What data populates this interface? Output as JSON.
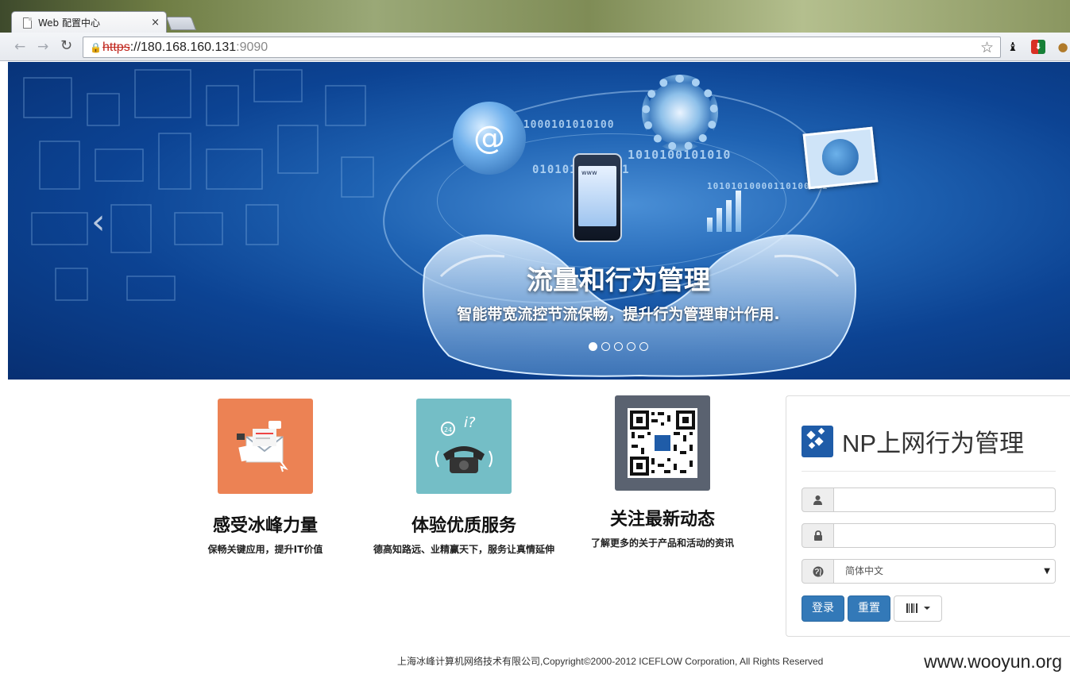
{
  "browser": {
    "tab_title": "Web 配置中心",
    "tab_close": "×",
    "url_scheme": "https",
    "url_sep": "://",
    "url_host": "180.168.160.131",
    "url_port": ":9090"
  },
  "banner": {
    "title": "流量和行为管理",
    "subtitle": "智能带宽流控节流保畅，提升行为管理审计作用.",
    "slide_count": 5,
    "active_slide": 1,
    "prev_glyph": "‹",
    "phone_text": "www",
    "binary": [
      "11000101010100",
      "1010100101010",
      "0101010010101",
      "10101010000110100101"
    ]
  },
  "features": [
    {
      "title": "感受冰峰力量",
      "desc": "保畅关键应用，提升IT价值",
      "color": "#ec8254",
      "icon": "email-icon"
    },
    {
      "title": "体验优质服务",
      "desc": "德高知路远、业精赢天下，服务让真情延伸",
      "color": "#74bec6",
      "icon": "telephone-icon"
    },
    {
      "title": "关注最新动态",
      "desc": "了解更多的关于产品和活动的资讯",
      "color": "#5a6270",
      "icon": "qr-code-icon"
    }
  ],
  "login": {
    "brand_title": "NP上网行为管理",
    "username_value": "",
    "password_value": "",
    "language_selected": "简体中文",
    "login_label": "登录",
    "reset_label": "重置"
  },
  "footer": {
    "copyright": "上海冰峰计算机网络技术有限公司,Copyright©2000-2012 ICEFLOW Corporation, All Rights Reserved",
    "watermark": "www.wooyun.org"
  }
}
